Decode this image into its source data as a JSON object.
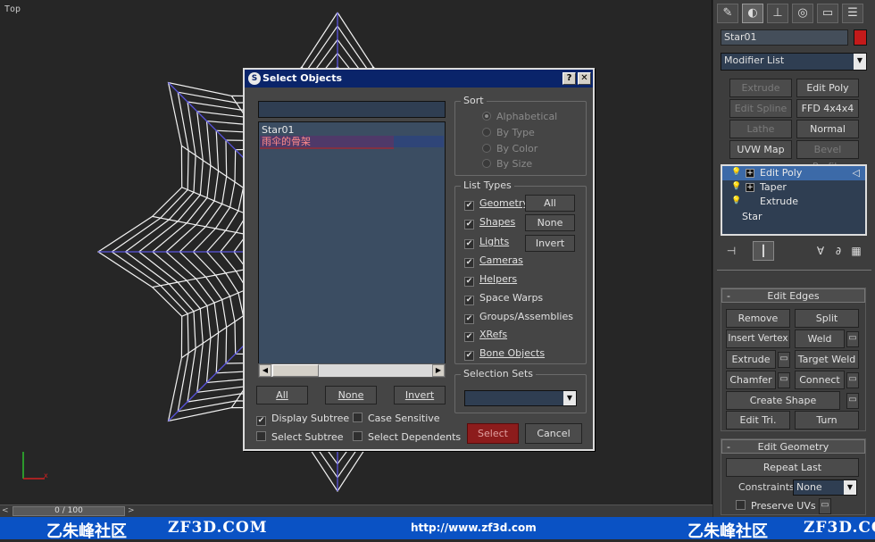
{
  "viewport": {
    "label": "Top",
    "axis_label": "x"
  },
  "timeline": {
    "frame": "0 / 100",
    "arrow_left": "<",
    "arrow_right": ">"
  },
  "footer": {
    "brand_left": "乙朱峰社区",
    "site_left": "ZF3D.COM",
    "url": "http://www.zf3d.com",
    "brand_right": "乙朱峰社区",
    "site_right": "ZF3D.COM"
  },
  "command_panel": {
    "tabs": [
      "create-tab",
      "modify-tab",
      "hierarchy-tab",
      "motion-tab",
      "display-tab",
      "utilities-tab"
    ],
    "object_name": "Star01",
    "object_color": "#c41a1a",
    "modifier_list": "Modifier List",
    "modifier_buttons": [
      {
        "label": "Extrude",
        "enabled": false
      },
      {
        "label": "Edit Poly",
        "enabled": true
      },
      {
        "label": "Edit Spline",
        "enabled": false
      },
      {
        "label": "FFD 4x4x4",
        "enabled": true
      },
      {
        "label": "Lathe",
        "enabled": false
      },
      {
        "label": "Normal",
        "enabled": true
      },
      {
        "label": "UVW Map",
        "enabled": true
      },
      {
        "label": "Bevel Profile",
        "enabled": false
      }
    ],
    "stack": [
      {
        "label": "Edit Poly",
        "selected": true
      },
      {
        "label": "Taper",
        "selected": false
      },
      {
        "label": "Extrude",
        "selected": false
      },
      {
        "label": "Star",
        "selected": false
      }
    ],
    "edit_edges": {
      "title": "Edit Edges",
      "remove": "Remove",
      "split": "Split",
      "insert_vertex": "Insert Vertex",
      "weld": "Weld",
      "extrude": "Extrude",
      "target_weld": "Target Weld",
      "chamfer": "Chamfer",
      "connect": "Connect",
      "create_shape": "Create Shape",
      "edit_tri": "Edit Tri.",
      "turn": "Turn"
    },
    "edit_geometry": {
      "title": "Edit Geometry",
      "repeat_last": "Repeat Last",
      "constraints_label": "Constraints:",
      "constraints_value": "None",
      "preserve_uvs": "Preserve UVs"
    }
  },
  "dialog": {
    "title": "Select Objects",
    "help_btn": "?",
    "close_btn": "✕",
    "objects": [
      {
        "name": "Star01",
        "selected": false
      },
      {
        "name": "雨伞的骨架",
        "selected": true
      }
    ],
    "all": "All",
    "none": "None",
    "invert": "Invert",
    "display_subtree": "Display Subtree",
    "case_sensitive": "Case Sensitive",
    "select_subtree": "Select Subtree",
    "select_dependents": "Select Dependents",
    "select": "Select",
    "cancel": "Cancel",
    "sort": {
      "title": "Sort",
      "options": [
        "Alphabetical",
        "By Type",
        "By Color",
        "By Size"
      ],
      "selected": "Alphabetical"
    },
    "list_types": {
      "title": "List Types",
      "items": [
        "Geometry",
        "Shapes",
        "Lights",
        "Cameras",
        "Helpers",
        "Space Warps",
        "Groups/Assemblies",
        "XRefs",
        "Bone Objects"
      ],
      "all": "All",
      "none": "None",
      "invert": "Invert"
    },
    "selection_sets": {
      "title": "Selection Sets"
    }
  }
}
